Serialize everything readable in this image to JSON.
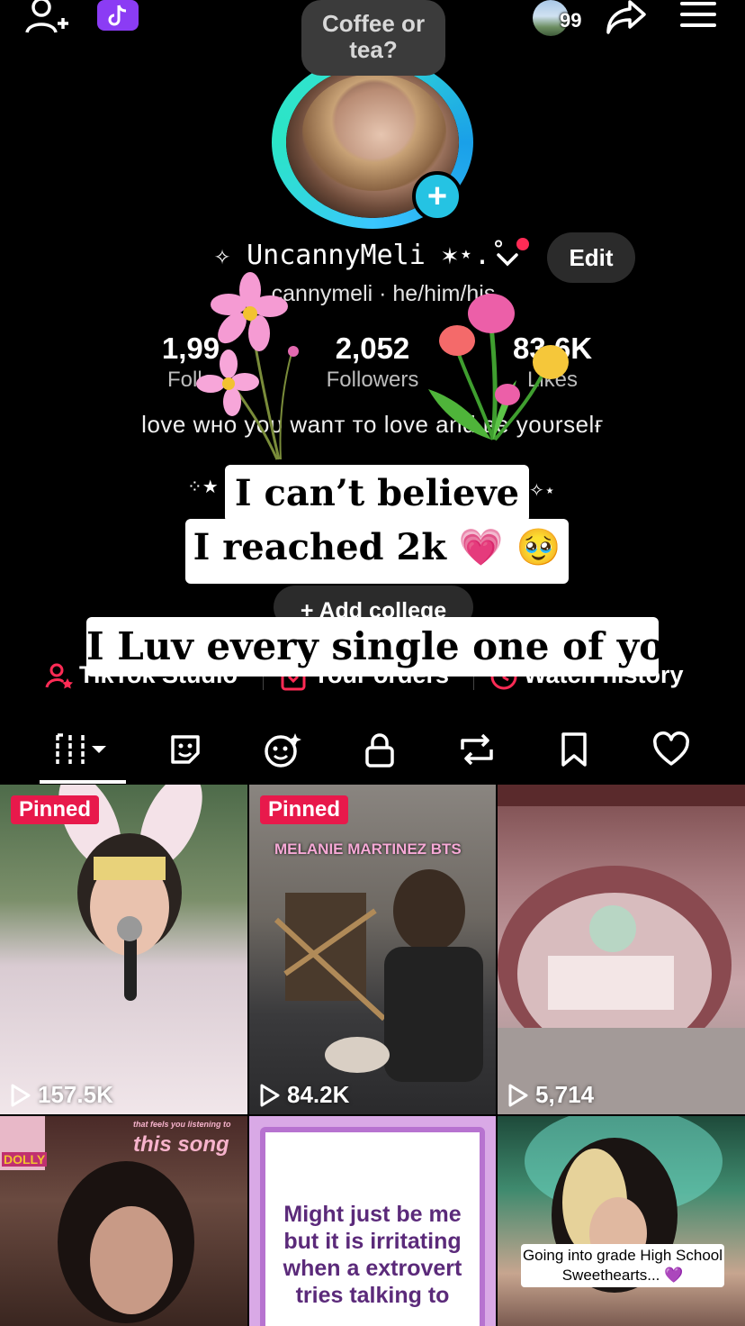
{
  "note": {
    "text": "Coffee or tea?"
  },
  "topbar": {
    "notification_count": "99"
  },
  "profile": {
    "username": "✧ UncannyMeli ✶⋆.˚",
    "edit_label": "Edit",
    "handle": "@uncannymeli · he/him/his",
    "handle_visible": "cannymeli · he/him/his",
    "bio": "love wнo yoυ wanт тo love and вe yoυrselғ",
    "add_college_label": "+ Add college"
  },
  "stats": {
    "following": {
      "value": "1,99",
      "label": "Follo"
    },
    "followers": {
      "value": "2,052",
      "label": "Followers"
    },
    "likes": {
      "value": "83.6K",
      "label": "Likes"
    }
  },
  "captions": {
    "line1": "I can’t believe",
    "line2": "I reached 2k 💗 🥹",
    "line3": "I Luv every single one of you"
  },
  "links": {
    "studio": "TikTok Studio",
    "orders": "Your orders",
    "watch": "Watch history"
  },
  "tabs": [
    "videos",
    "stickers",
    "ai-self",
    "private",
    "reposts",
    "favorites",
    "liked"
  ],
  "grid": [
    {
      "pinned": "Pinned",
      "views": "157.5K"
    },
    {
      "pinned": "Pinned",
      "views": "84.2K",
      "overlay": "MELANIE MARTINEZ BTS"
    },
    {
      "views": "5,714"
    },
    {
      "overlay_top": "this song",
      "overlay_small": "that feels you listening to",
      "badge": "DOLLY"
    },
    {
      "text": "Might just be me but it is irritating when a extrovert tries talking to"
    },
    {
      "caption": "Going into grade High School Sweethearts... 💜"
    }
  ],
  "colors": {
    "accent": "#25c3e3",
    "pinned": "#e8194b",
    "background": "#000000"
  }
}
